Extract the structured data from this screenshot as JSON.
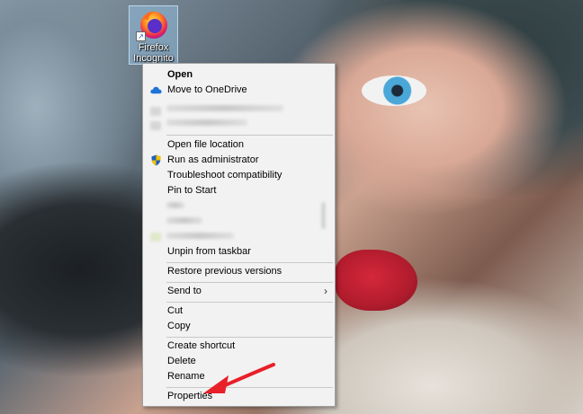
{
  "desktop": {
    "icon_label_line1": "Firefox",
    "icon_label_line2": "Incognito",
    "shortcut_glyph": "↗"
  },
  "context_menu": {
    "items": [
      {
        "label": "Open",
        "bold": true
      },
      {
        "label": "Move to OneDrive",
        "icon": "onedrive-cloud-icon"
      },
      {
        "label": "Open file location"
      },
      {
        "label": "Run as administrator",
        "icon": "uac-shield-icon"
      },
      {
        "label": "Troubleshoot compatibility"
      },
      {
        "label": "Pin to Start"
      },
      {
        "label": "Unpin from taskbar"
      },
      {
        "label": "Restore previous versions"
      },
      {
        "label": "Send to",
        "submenu": true
      },
      {
        "label": "Cut"
      },
      {
        "label": "Copy"
      },
      {
        "label": "Create shortcut"
      },
      {
        "label": "Delete"
      },
      {
        "label": "Rename"
      },
      {
        "label": "Properties"
      }
    ],
    "submenu_arrow": "›"
  },
  "colors": {
    "annotation_arrow": "#e8202a",
    "onedrive_blue": "#1e73d8",
    "menu_background": "#f2f2f2"
  }
}
